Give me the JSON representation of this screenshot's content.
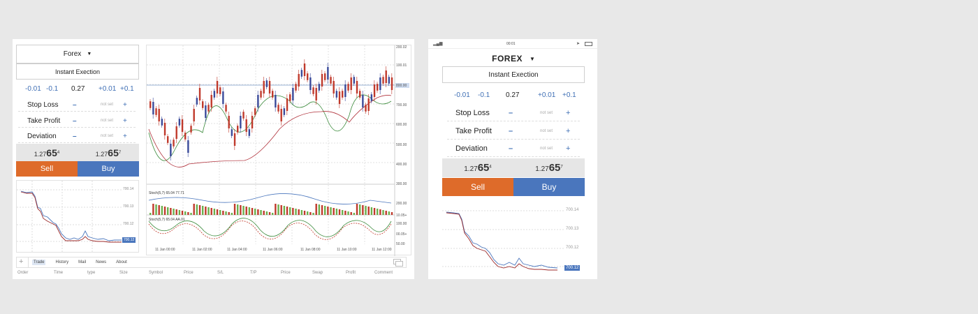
{
  "desktop": {
    "selector": {
      "label": "Forex"
    },
    "mode": {
      "label": "Instant Exection"
    },
    "volume": {
      "minus2": "-0.01",
      "minus1": "-0.1",
      "value": "0.27",
      "plus1": "+0.01",
      "plus2": "+0.1"
    },
    "params": [
      {
        "label": "Stop Loss",
        "minus": "–",
        "value": "not set",
        "plus": "+"
      },
      {
        "label": "Take Profit",
        "minus": "–",
        "value": "not set",
        "plus": "+"
      },
      {
        "label": "Deviation",
        "minus": "–",
        "value": "not set",
        "plus": "+"
      }
    ],
    "bid": {
      "base": "1.27",
      "big": "65",
      "sup": "4"
    },
    "ask": {
      "base": "1.27",
      "big": "65",
      "sup": "7"
    },
    "sell_label": "Sell",
    "buy_label": "Buy",
    "mini_chart": {
      "ticks": [
        "700.14",
        "700.13",
        "700.12"
      ],
      "current": "700.12"
    },
    "main_chart": {
      "price_ticks": [
        "200.02",
        "100.01",
        "800.00",
        "700.00",
        "600.00",
        "500.00",
        "400.00",
        "300.00"
      ],
      "stoch1_label": "Stoch(5,7) 65.04 77.71",
      "stoch1_ticks": [
        "200.00",
        "10.05+"
      ],
      "stoch2_label": "Stoch(5,7) 65.04 AA.01",
      "stoch2_ticks": [
        "100.00",
        "00.05+",
        "50.00"
      ],
      "time_ticks": [
        "11 Jan 00:00",
        "11 Jan 02:00",
        "11 Jan 04:00",
        "11 Jan 06:00",
        "11 Jan 08:00",
        "11 Jan 10:00",
        "11 Jan 12:00"
      ]
    },
    "tabs": [
      "Trade",
      "History",
      "Mail",
      "News",
      "About"
    ],
    "add_tab": "+",
    "columns": [
      "Order",
      "Time",
      "type",
      "Size",
      "Symbol",
      "Price",
      "S/L",
      "T/P",
      "Price",
      "Swap",
      "Profit",
      "Comment"
    ]
  },
  "mobile": {
    "status_time": "00:01",
    "selector": {
      "label": "FOREX"
    },
    "mode": {
      "label": "Instant Exection"
    },
    "volume": {
      "minus2": "-0.01",
      "minus1": "-0.1",
      "value": "0.27",
      "plus1": "+0.01",
      "plus2": "+0.1"
    },
    "params": [
      {
        "label": "Stop Loss",
        "minus": "–",
        "value": "not set",
        "plus": "+"
      },
      {
        "label": "Take Profit",
        "minus": "–",
        "value": "not set",
        "plus": "+"
      },
      {
        "label": "Deviation",
        "minus": "–",
        "value": "not set",
        "plus": "+"
      }
    ],
    "bid": {
      "base": "1.27",
      "big": "65",
      "sup": "4"
    },
    "ask": {
      "base": "1.27",
      "big": "65",
      "sup": "7"
    },
    "sell_label": "Sell",
    "buy_label": "Buy",
    "mini_chart": {
      "ticks": [
        "700.14",
        "700.13",
        "700.12"
      ],
      "current": "700.12"
    }
  },
  "colors": {
    "sell": "#de6b2a",
    "buy": "#4a76bd",
    "bull": "#c0392b",
    "bear": "#3a4a9a"
  }
}
